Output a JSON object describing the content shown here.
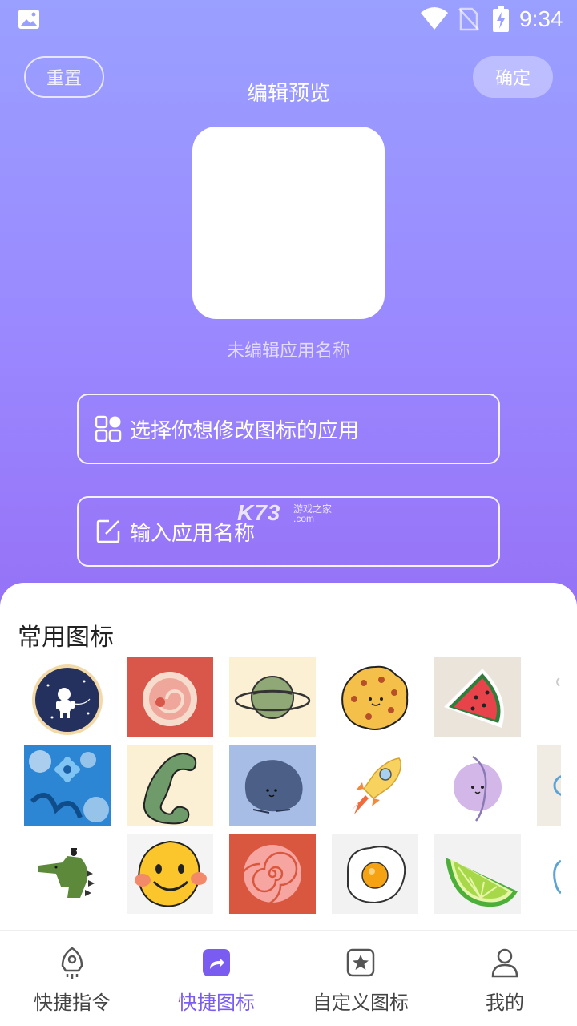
{
  "status_bar": {
    "time": "9:34",
    "icons": [
      "image-icon",
      "wifi-icon",
      "no-sim-icon",
      "battery-charging-icon"
    ]
  },
  "header": {
    "reset_label": "重置",
    "confirm_label": "确定",
    "title": "编辑预览"
  },
  "preview": {
    "app_name": "未编辑应用名称"
  },
  "actions": {
    "select_app_label": "选择你想修改图标的应用",
    "input_name_label": "输入应用名称"
  },
  "watermark": {
    "brand": "K73",
    "tagline": "游戏之家",
    "domain": ".com"
  },
  "icons_section": {
    "title": "常用图标",
    "icons": [
      "astronaut-icon",
      "cake-roll-icon",
      "planet-icon",
      "cookie-icon",
      "watermelon-icon",
      "partial-icon",
      "blue-flower-icon",
      "phone-handset-icon",
      "blue-blob-icon",
      "rocket-icon",
      "purple-planet-icon",
      "partial-icon",
      "green-dinosaur-icon",
      "smiley-face-icon",
      "pink-spiral-icon",
      "fried-egg-icon",
      "lime-slice-icon",
      "partial-icon"
    ]
  },
  "bottom_nav": {
    "items": [
      {
        "label": "快捷指令",
        "icon": "rocket-outline-icon"
      },
      {
        "label": "快捷图标",
        "icon": "share-arrow-icon"
      },
      {
        "label": "自定义图标",
        "icon": "star-square-icon"
      },
      {
        "label": "我的",
        "icon": "person-icon"
      }
    ],
    "active_color": "#7b5cf0"
  },
  "colors": {
    "gradient_top": "#9aa0ff",
    "gradient_bottom": "#9672f6",
    "accent": "#7b5cf0"
  }
}
